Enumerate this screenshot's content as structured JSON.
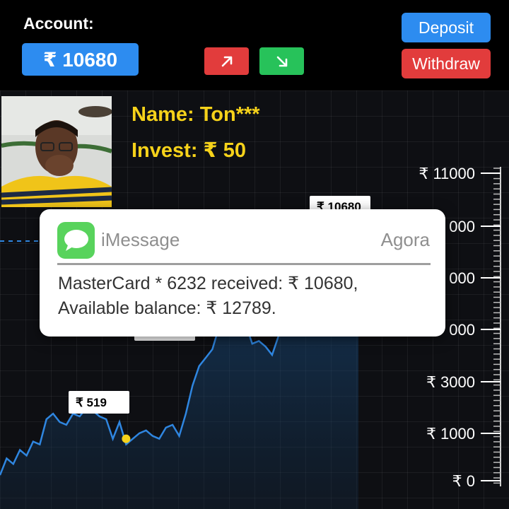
{
  "header": {
    "account_label": "Account:",
    "balance": "₹ 10680",
    "deposit_label": "Deposit",
    "withdraw_label": "Withdraw"
  },
  "colors": {
    "background": "#000000",
    "accent_blue": "#2d8cf0",
    "up_red": "#e23c3c",
    "down_green": "#27c25a",
    "highlight_yellow": "#f6d21a",
    "line_blue": "#2f86e0"
  },
  "user": {
    "name": "Name: Ton***",
    "invest": "Invest: ₹ 50"
  },
  "notification": {
    "app": "iMessage",
    "sender": "Agora",
    "line1": "MasterCard * 6232 received: ₹ 10680,",
    "line2": "Available balance: ₹ 12789."
  },
  "chart_data": {
    "type": "line",
    "y_axis_labels": [
      "₹ 11000",
      "₹ 9000",
      "₹ 7000",
      "₹ 5000",
      "₹ 3000",
      "₹ 1000",
      "₹ 0"
    ],
    "y_axis_visible_labels": [
      "₹ 11000",
      "000",
      "000",
      "000",
      "₹ 3000",
      "₹ 1000",
      "₹ 0"
    ],
    "data_labels": [
      "₹ 519",
      "₹ 10680"
    ],
    "series": [
      {
        "values": [
          200,
          800,
          600,
          1100,
          900,
          1400,
          1300,
          2200,
          2400,
          2100,
          2000,
          2400,
          2300,
          2600,
          2500,
          2300,
          2200,
          1500,
          2100,
          1300,
          1500,
          1700,
          1800,
          1600,
          1500,
          1900,
          2000,
          1600,
          2400,
          3400,
          4100,
          4400,
          4700,
          5500,
          5800,
          5900,
          6000,
          5600,
          4900,
          5000,
          4800,
          4500,
          5200,
          6100,
          6800,
          6700,
          7000,
          7200,
          7400,
          7600,
          7800,
          8100,
          8400,
          8600,
          8700
        ]
      }
    ],
    "markers": [
      {
        "x_index": 19,
        "value": 1500
      },
      {
        "x_index": 36,
        "value": 5900
      }
    ],
    "ylim": [
      0,
      11000
    ]
  }
}
